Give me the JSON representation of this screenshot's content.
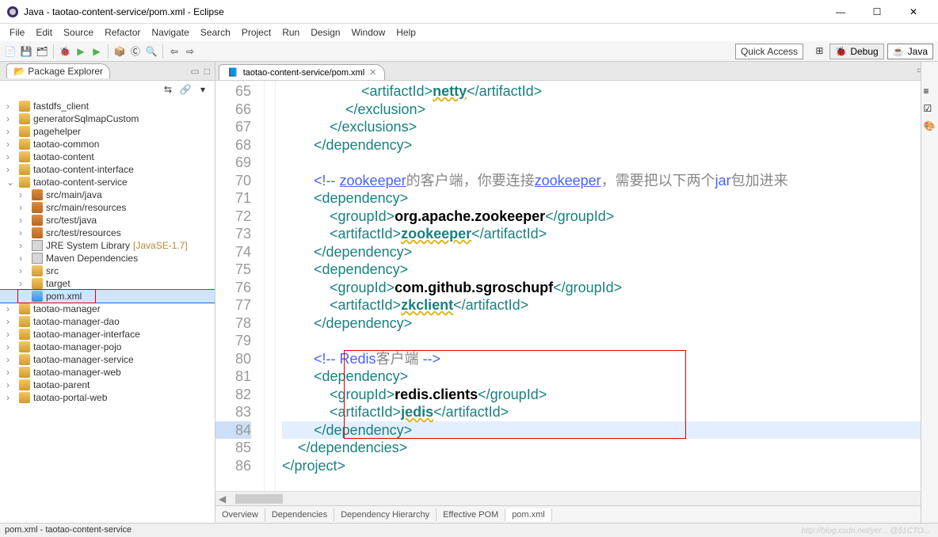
{
  "window": {
    "title": "Java - taotao-content-service/pom.xml - Eclipse",
    "min": "—",
    "max": "☐",
    "close": "✕"
  },
  "menu": [
    "File",
    "Edit",
    "Source",
    "Refactor",
    "Navigate",
    "Search",
    "Project",
    "Run",
    "Design",
    "Window",
    "Help"
  ],
  "quick_access": "Quick Access",
  "perspectives": {
    "debug": "Debug",
    "java": "Java"
  },
  "package_explorer": {
    "title": "Package Explorer",
    "projects": [
      {
        "label": "fastdfs_client",
        "ico": "ico-folder"
      },
      {
        "label": "generatorSqlmapCustom",
        "ico": "ico-folder"
      },
      {
        "label": "pagehelper",
        "ico": "ico-folder"
      },
      {
        "label": "taotao-common",
        "ico": "ico-folder"
      },
      {
        "label": "taotao-content",
        "ico": "ico-folder"
      },
      {
        "label": "taotao-content-interface",
        "ico": "ico-folder"
      }
    ],
    "open_project": "taotao-content-service",
    "open_children": [
      {
        "label": "src/main/java",
        "ico": "ico-pkg",
        "indent": 1
      },
      {
        "label": "src/main/resources",
        "ico": "ico-pkg",
        "indent": 1
      },
      {
        "label": "src/test/java",
        "ico": "ico-pkg",
        "indent": 1
      },
      {
        "label": "src/test/resources",
        "ico": "ico-pkg",
        "indent": 1
      },
      {
        "label": "JRE System Library",
        "suffix": "[JavaSE-1.7]",
        "ico": "ico-jar",
        "indent": 1
      },
      {
        "label": "Maven Dependencies",
        "ico": "ico-jar",
        "indent": 1
      },
      {
        "label": "src",
        "ico": "ico-folder",
        "indent": 1
      },
      {
        "label": "target",
        "ico": "ico-folder",
        "indent": 1
      },
      {
        "label": "pom.xml",
        "ico": "ico-xml",
        "indent": 1,
        "sel": true
      }
    ],
    "trailing_projects": [
      "taotao-manager",
      "taotao-manager-dao",
      "taotao-manager-interface",
      "taotao-manager-pojo",
      "taotao-manager-service",
      "taotao-manager-web",
      "taotao-parent",
      "taotao-portal-web"
    ]
  },
  "editor": {
    "tab": "taotao-content-service/pom.xml",
    "bottom_tabs": [
      "Overview",
      "Dependencies",
      "Dependency Hierarchy",
      "Effective POM",
      "pom.xml"
    ],
    "active_bottom": "pom.xml",
    "lines": [
      {
        "n": 65,
        "html": "                    <span class='c-tag'>&lt;artifactId&gt;</span><span class='c-warn c-txt'>netty</span><span class='c-tag'>&lt;/artifactId&gt;</span>"
      },
      {
        "n": 66,
        "html": "                <span class='c-tag'>&lt;/exclusion&gt;</span>"
      },
      {
        "n": 67,
        "html": "            <span class='c-tag'>&lt;/exclusions&gt;</span>"
      },
      {
        "n": 68,
        "html": "        <span class='c-tag'>&lt;/dependency&gt;</span>"
      },
      {
        "n": 69,
        "html": ""
      },
      {
        "n": 70,
        "html": "        <span class='c-cmt'>&lt;!-- </span><span class='c-cmt'><u>zookeeper</u></span><span class='c-cmtcn'>的客户端，你要连接</span><span class='c-cmt'><u>zookeeper</u></span><span class='c-cmtcn'>，需要把以下两个</span><span class='c-cmt'>jar</span><span class='c-cmtcn'>包加进来 </span>"
      },
      {
        "n": 71,
        "html": "        <span class='c-tag'>&lt;dependency&gt;</span>"
      },
      {
        "n": 72,
        "html": "            <span class='c-tag'>&lt;groupId&gt;</span><span class='c-txt'>org.apache.zookeeper</span><span class='c-tag'>&lt;/groupId&gt;</span>"
      },
      {
        "n": 73,
        "html": "            <span class='c-tag'>&lt;artifactId&gt;</span><span class='c-warn c-txt'>zookeeper</span><span class='c-tag'>&lt;/artifactId&gt;</span>"
      },
      {
        "n": 74,
        "html": "        <span class='c-tag'>&lt;/dependency&gt;</span>"
      },
      {
        "n": 75,
        "html": "        <span class='c-tag'>&lt;dependency&gt;</span>"
      },
      {
        "n": 76,
        "html": "            <span class='c-tag'>&lt;groupId&gt;</span><span class='c-txt'>com.github.sgroschupf</span><span class='c-tag'>&lt;/groupId&gt;</span>"
      },
      {
        "n": 77,
        "html": "            <span class='c-tag'>&lt;artifactId&gt;</span><span class='c-warn c-txt'>zkclient</span><span class='c-tag'>&lt;/artifactId&gt;</span>"
      },
      {
        "n": 78,
        "html": "        <span class='c-tag'>&lt;/dependency&gt;</span>"
      },
      {
        "n": 79,
        "html": ""
      },
      {
        "n": 80,
        "html": "        <span class='c-cmt'>&lt;!-- Redis</span><span class='c-cmtcn'>客户端</span> <span class='c-cmt'>--&gt;</span>"
      },
      {
        "n": 81,
        "html": "        <span class='c-tag'>&lt;dependency&gt;</span>"
      },
      {
        "n": 82,
        "html": "            <span class='c-tag'>&lt;groupId&gt;</span><span class='c-txt'>redis.clients</span><span class='c-tag'>&lt;/groupId&gt;</span>"
      },
      {
        "n": 83,
        "html": "            <span class='c-tag'>&lt;artifactId&gt;</span><span class='c-warn c-txt'>jedis</span><span class='c-tag'>&lt;/artifactId&gt;</span>"
      },
      {
        "n": 84,
        "html": "        <span class='c-tag'>&lt;/dependency&gt;</span>",
        "active": true
      },
      {
        "n": 85,
        "html": "    <span class='c-tag'>&lt;/dependencies&gt;</span>"
      },
      {
        "n": 86,
        "html": "<span class='c-tag'>&lt;/project&gt;</span>"
      }
    ]
  },
  "status": "pom.xml - taotao-content-service",
  "watermark": "http://blog.csdn.net/yer... @51CTO..."
}
